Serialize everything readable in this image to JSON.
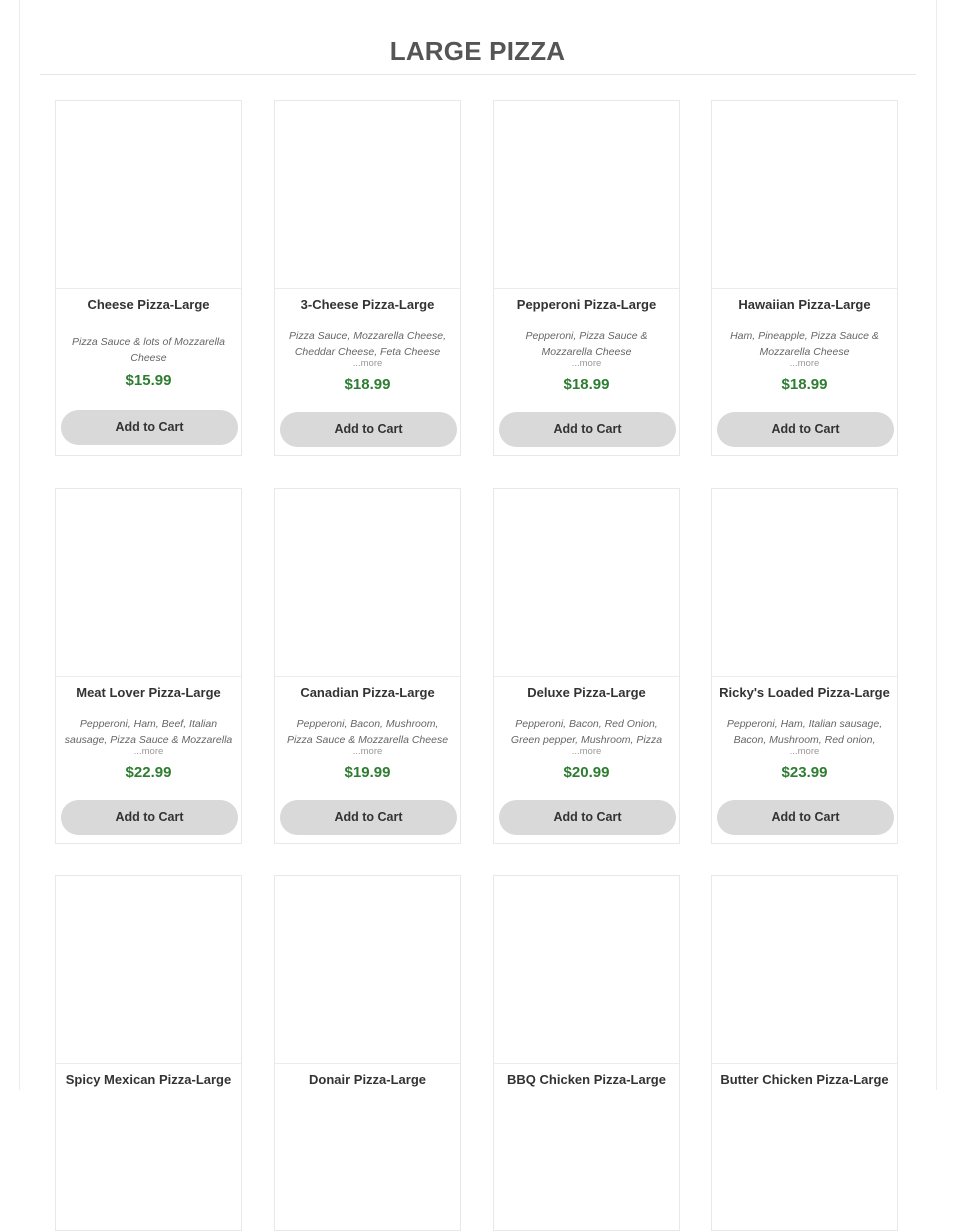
{
  "section": {
    "title": "LARGE PIZZA"
  },
  "products": [
    {
      "name": "Cheese Pizza-Large",
      "description": "Pizza Sauce & lots of Mozzarella Cheese",
      "more": "",
      "price": "$15.99",
      "button": "Add to Cart"
    },
    {
      "name": "3-Cheese Pizza-Large",
      "description": "Pizza Sauce, Mozzarella Cheese, Cheddar Cheese, Feta Cheese",
      "more": "...more",
      "price": "$18.99",
      "button": "Add to Cart"
    },
    {
      "name": "Pepperoni Pizza-Large",
      "description": "Pepperoni, Pizza Sauce & Mozzarella Cheese",
      "more": "...more",
      "price": "$18.99",
      "button": "Add to Cart"
    },
    {
      "name": "Hawaiian Pizza-Large",
      "description": "Ham, Pineapple, Pizza Sauce & Mozzarella Cheese",
      "more": "...more",
      "price": "$18.99",
      "button": "Add to Cart"
    },
    {
      "name": "Meat Lover Pizza-Large",
      "description": "Pepperoni, Ham, Beef, Italian sausage, Pizza Sauce & Mozzarella",
      "more": "...more",
      "price": "$22.99",
      "button": "Add to Cart"
    },
    {
      "name": "Canadian Pizza-Large",
      "description": "Pepperoni, Bacon, Mushroom, Pizza Sauce & Mozzarella Cheese",
      "more": "...more",
      "price": "$19.99",
      "button": "Add to Cart"
    },
    {
      "name": "Deluxe Pizza-Large",
      "description": "Pepperoni, Bacon, Red Onion, Green pepper, Mushroom, Pizza",
      "more": "...more",
      "price": "$20.99",
      "button": "Add to Cart"
    },
    {
      "name": "Ricky's Loaded Pizza-Large",
      "description": "Pepperoni, Ham, Italian sausage, Bacon, Mushroom, Red onion,",
      "more": "...more",
      "price": "$23.99",
      "button": "Add to Cart"
    },
    {
      "name": "Spicy Mexican Pizza-Large"
    },
    {
      "name": "Donair Pizza-Large"
    },
    {
      "name": "BBQ Chicken Pizza-Large"
    },
    {
      "name": "Butter Chicken Pizza-Large"
    }
  ]
}
